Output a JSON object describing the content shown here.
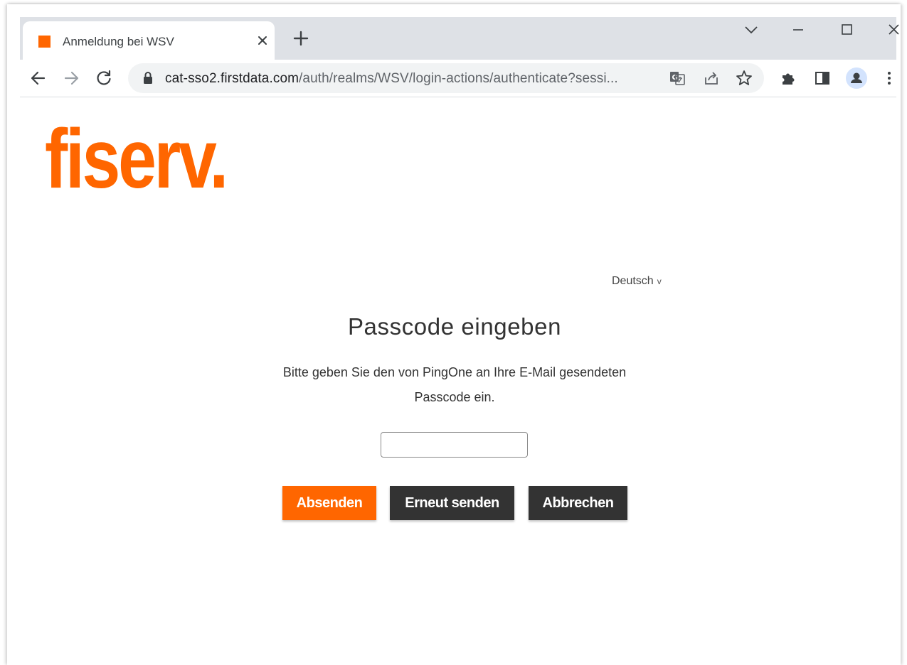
{
  "browser": {
    "tab": {
      "title": "Anmeldung bei WSV",
      "favicon_color": "#ff6600"
    },
    "omnibox": {
      "host": "cat-sso2.firstdata.com",
      "path": "/auth/realms/WSV/login-actions/authenticate?sessi..."
    },
    "icons": [
      "back-icon",
      "forward-icon",
      "reload-icon",
      "lock-icon",
      "translate-icon",
      "share-icon",
      "star-icon",
      "extensions-icon",
      "side-panel-icon",
      "profile-icon",
      "menu-icon",
      "tab-search-icon",
      "minimize-icon",
      "maximize-icon",
      "close-window-icon"
    ]
  },
  "page": {
    "logo": "fiserv.",
    "language": {
      "selected": "Deutsch",
      "chevron": "v"
    },
    "heading": "Passcode eingeben",
    "description_line1": "Bitte geben Sie den von PingOne an Ihre E-Mail gesendeten",
    "description_line2": "Passcode ein.",
    "passcode": {
      "value": "",
      "placeholder": ""
    },
    "buttons": {
      "submit": "Absenden",
      "resend": "Erneut senden",
      "cancel": "Abbrechen"
    },
    "colors": {
      "brand": "#ff6600",
      "dark_button": "#333333",
      "text": "#333333"
    }
  }
}
